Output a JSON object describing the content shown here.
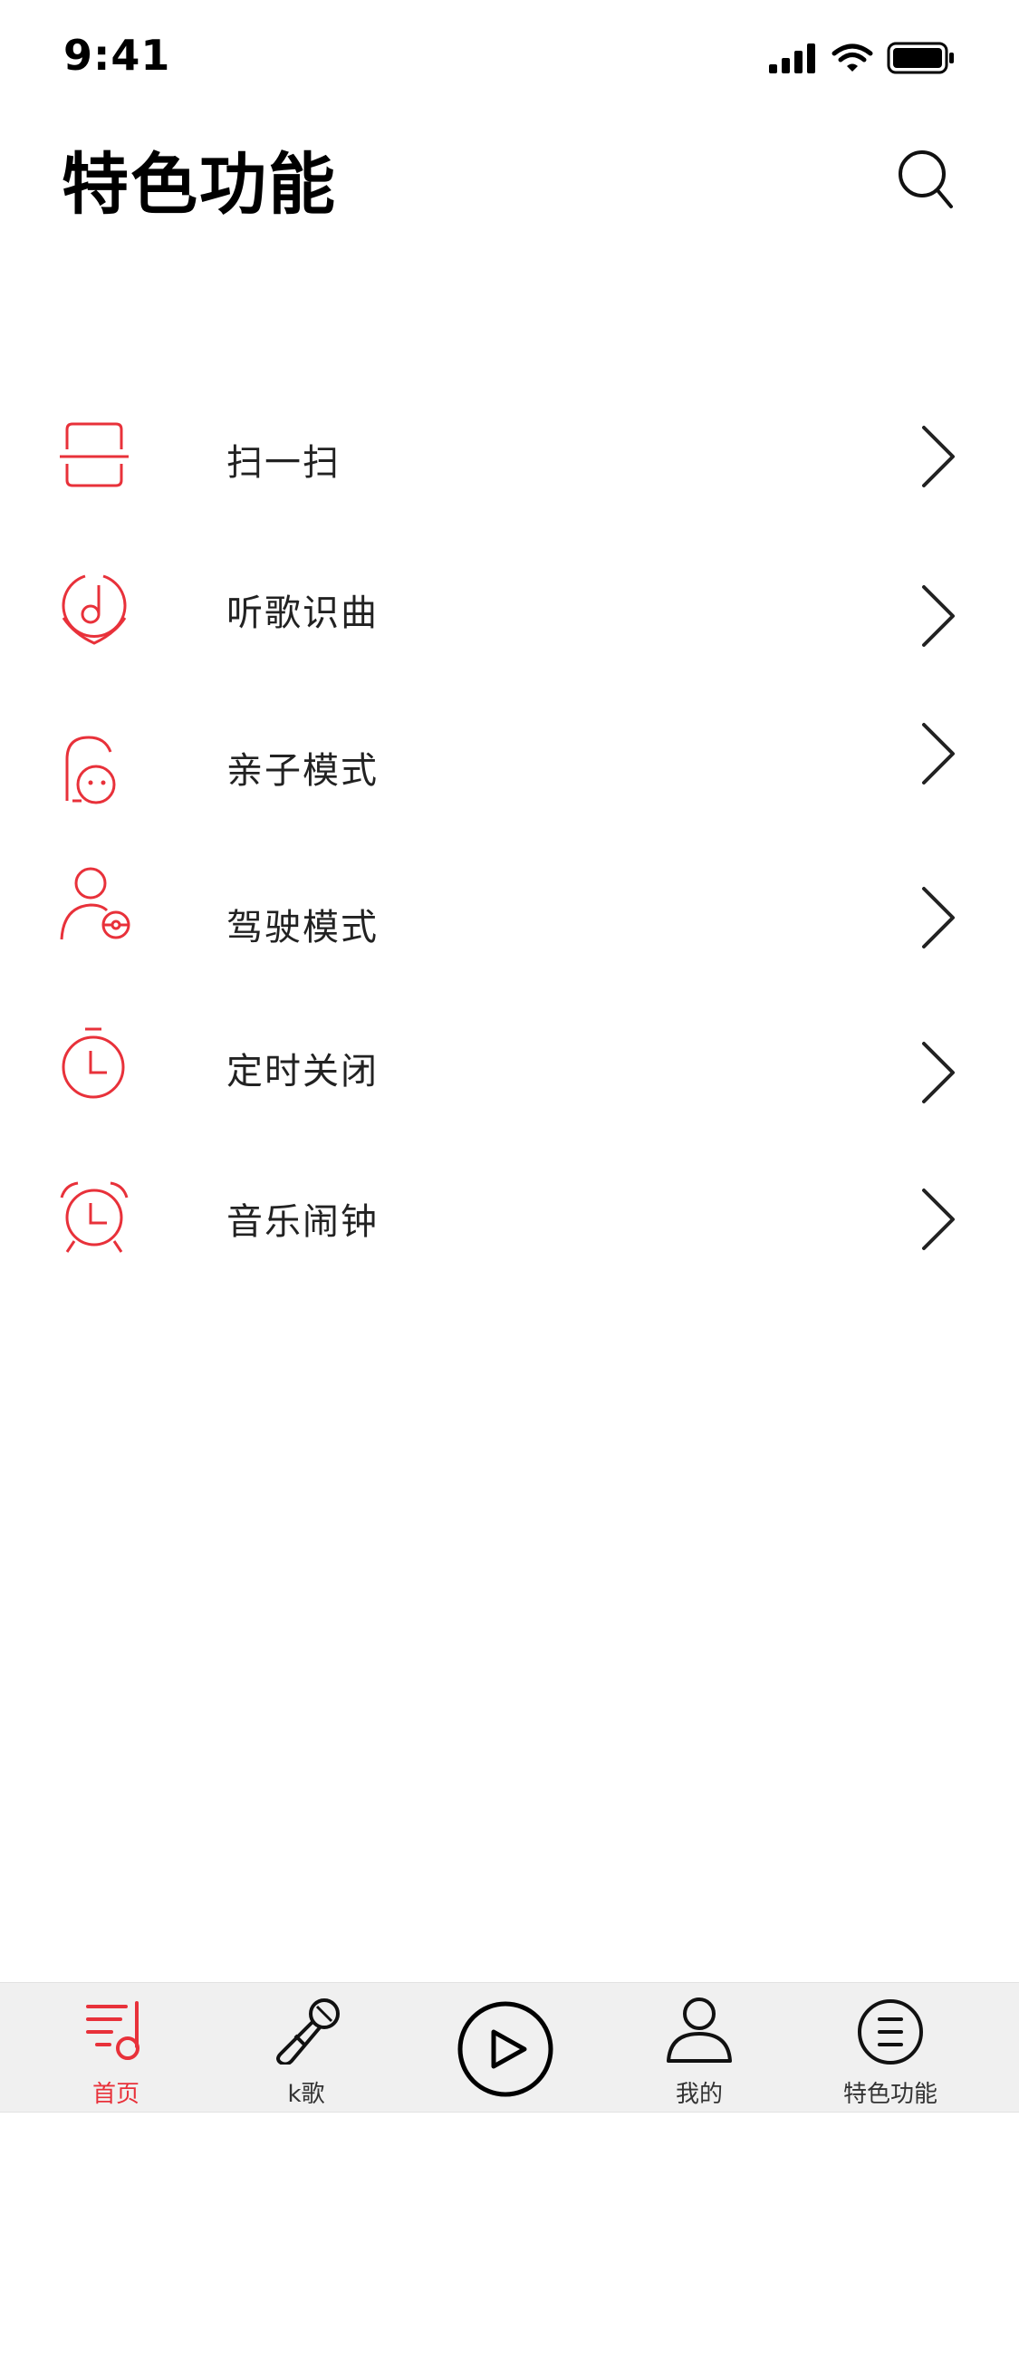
{
  "status_bar": {
    "time": "9:41"
  },
  "header": {
    "title": "特色功能"
  },
  "menu": [
    {
      "label": "扫一扫",
      "icon": "scan-icon"
    },
    {
      "label": "听歌识曲",
      "icon": "music-recognition-icon"
    },
    {
      "label": "亲子模式",
      "icon": "child-mode-icon"
    },
    {
      "label": "驾驶模式",
      "icon": "driving-mode-icon"
    },
    {
      "label": "定时关闭",
      "icon": "timer-icon"
    },
    {
      "label": "音乐闹钟",
      "icon": "alarm-clock-icon"
    }
  ],
  "tab_bar": {
    "items": [
      {
        "label": "首页",
        "icon": "music-list-icon",
        "active": true
      },
      {
        "label": "k歌",
        "icon": "microphone-icon",
        "active": false
      },
      {
        "label": "",
        "icon": "play-icon",
        "active": false
      },
      {
        "label": "我的",
        "icon": "user-icon",
        "active": false
      },
      {
        "label": "特色功能",
        "icon": "menu-circle-icon",
        "active": false
      }
    ]
  },
  "colors": {
    "accent": "#e8313a",
    "text": "#222222",
    "tab_bar_bg": "#f0f0f0"
  }
}
